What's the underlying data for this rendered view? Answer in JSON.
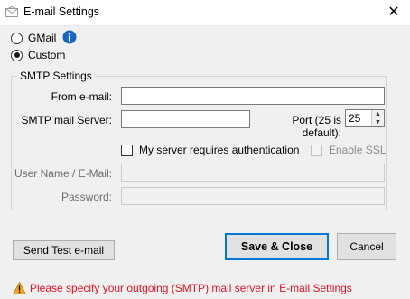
{
  "window": {
    "title": "E-mail Settings",
    "close_glyph": "✕"
  },
  "provider": {
    "gmail_label": "GMail",
    "custom_label": "Custom",
    "selected": "custom",
    "info_icon": "info-icon"
  },
  "smtp": {
    "group_label": "SMTP Settings",
    "from_label": "From e-mail:",
    "from_value": "",
    "server_label": "SMTP mail Server:",
    "server_value": "",
    "port_label": "Port (25 is default):",
    "port_value": "25",
    "auth_label": "My server requires authentication",
    "auth_checked": false,
    "ssl_label": "Enable SSL",
    "ssl_checked": false,
    "username_label": "User Name / E-Mail:",
    "username_value": "",
    "password_label": "Password:",
    "password_value": ""
  },
  "buttons": {
    "send_test": "Send Test e-mail",
    "save_close": "Save & Close",
    "cancel": "Cancel"
  },
  "status": {
    "message": "Please specify your outgoing (SMTP) mail server in E-mail Settings",
    "color": "#e81123"
  },
  "colors": {
    "accent": "#0078d7",
    "info": "#1565c0",
    "warning": "#f5a623"
  }
}
